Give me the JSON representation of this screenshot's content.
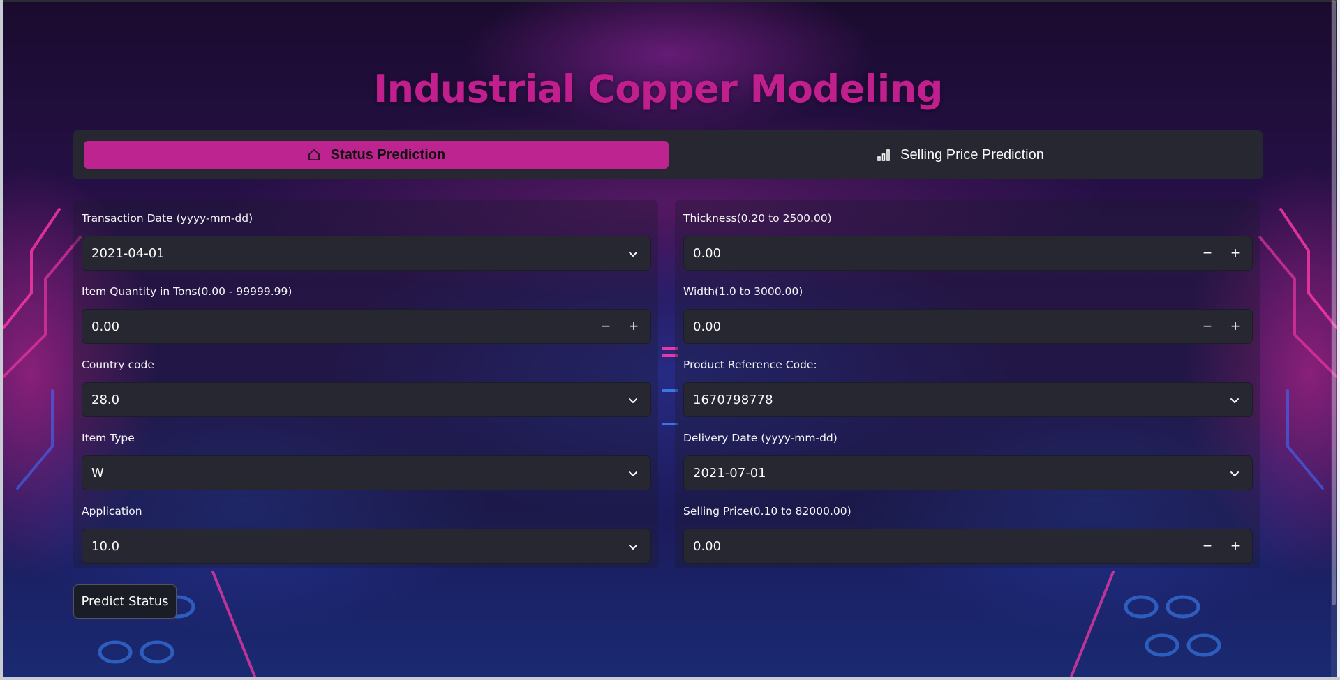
{
  "app": {
    "title": "Industrial Copper Modeling"
  },
  "tabs": [
    {
      "label": "Status Prediction",
      "icon": "home-icon",
      "active": true
    },
    {
      "label": "Selling Price Prediction",
      "icon": "bar-chart-icon",
      "active": false
    }
  ],
  "form": {
    "left": [
      {
        "label": "Transaction Date (yyyy-mm-dd)",
        "value": "2021-04-01",
        "type": "select"
      },
      {
        "label": "Item Quantity in Tons(0.00 - 99999.99)",
        "value": "0.00",
        "type": "number"
      },
      {
        "label": "Country code",
        "value": "28.0",
        "type": "select"
      },
      {
        "label": "Item Type",
        "value": "W",
        "type": "select"
      },
      {
        "label": "Application",
        "value": "10.0",
        "type": "select"
      }
    ],
    "right": [
      {
        "label": "Thickness(0.20 to 2500.00)",
        "value": "0.00",
        "type": "number"
      },
      {
        "label": "Width(1.0 to 3000.00)",
        "value": "0.00",
        "type": "number"
      },
      {
        "label": "Product Reference Code:",
        "value": "1670798778",
        "type": "select"
      },
      {
        "label": "Delivery Date (yyyy-mm-dd)",
        "value": "2021-07-01",
        "type": "select"
      },
      {
        "label": "Selling Price(0.10 to 82000.00)",
        "value": "0.00",
        "type": "number"
      }
    ]
  },
  "stepper": {
    "minus": "−",
    "plus": "+"
  },
  "actions": {
    "predict_label": "Predict Status"
  },
  "colors": {
    "accent": "#be2490",
    "title": "#c21f8e",
    "panel": "#262730"
  }
}
